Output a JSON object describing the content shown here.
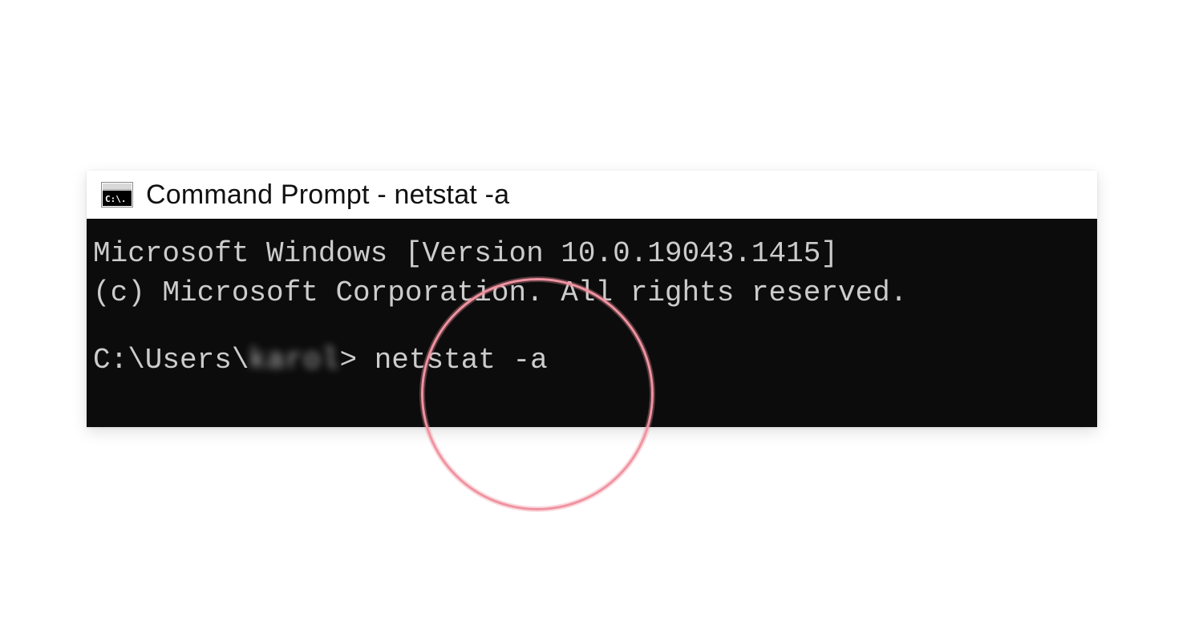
{
  "window": {
    "title": "Command Prompt - netstat  -a"
  },
  "terminal": {
    "version_line": "Microsoft Windows [Version 10.0.19043.1415]",
    "copyright_line": "(c) Microsoft Corporation. All rights reserved.",
    "prompt_prefix": "C:\\Users\\",
    "username_blurred": "karol",
    "prompt_suffix": "> ",
    "command": "netstat -a"
  }
}
